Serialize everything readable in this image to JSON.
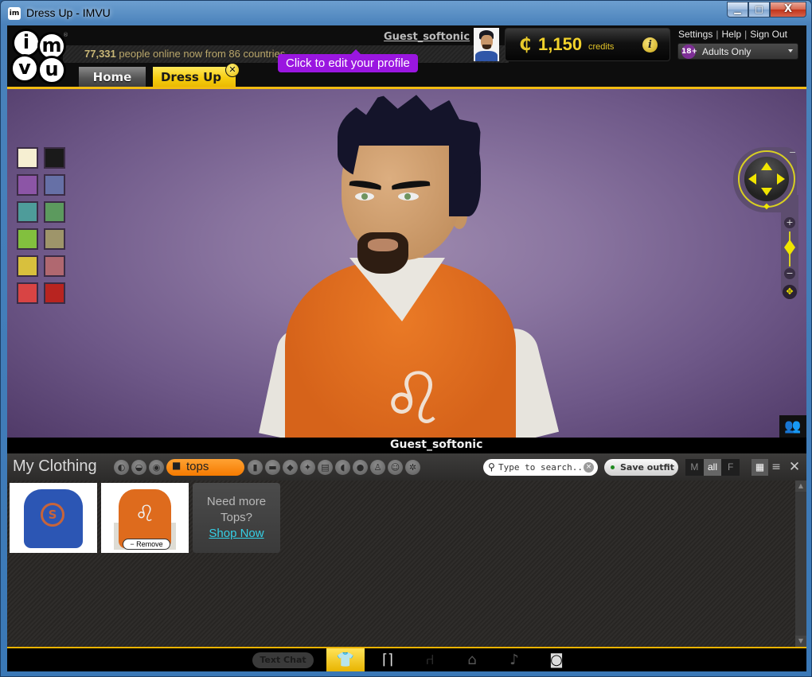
{
  "window": {
    "title": "Dress Up - IMVU",
    "app_icon": "imvu-app-icon",
    "controls": {
      "minimize": "▁",
      "maximize": "□",
      "close": "X"
    }
  },
  "header": {
    "logo": {
      "letters": [
        "i",
        "m",
        "v",
        "u"
      ],
      "registered": "®"
    },
    "online": {
      "count": "77,331",
      "text": "people online now from 86 countries"
    },
    "username": "Guest_softonic",
    "tooltip": "Click to edit your profile",
    "credits": {
      "symbol": "₵",
      "amount": "1,150",
      "label": "credits",
      "info_icon": "i"
    },
    "links": [
      {
        "label": "Settings"
      },
      {
        "label": "Help"
      },
      {
        "label": "Sign Out"
      }
    ],
    "separator": "|",
    "rating": {
      "badge": "18+",
      "label": "Adults Only"
    },
    "tabs": [
      {
        "label": "Home",
        "active": false
      },
      {
        "label": "Dress Up",
        "active": true,
        "closable": true,
        "close_glyph": "✕"
      }
    ]
  },
  "scene": {
    "swatches": [
      {
        "name": "cream",
        "color": "#f6efd2"
      },
      {
        "name": "black",
        "color": "#1a1a1a"
      },
      {
        "name": "purple",
        "color": "#8c55a6"
      },
      {
        "name": "slate-blue",
        "color": "#6670a6"
      },
      {
        "name": "teal",
        "color": "#4e9c9a"
      },
      {
        "name": "green",
        "color": "#5c9a5e"
      },
      {
        "name": "lime",
        "color": "#82c03e"
      },
      {
        "name": "khaki",
        "color": "#9e956a"
      },
      {
        "name": "yellow",
        "color": "#d8c03d"
      },
      {
        "name": "rose",
        "color": "#b06870"
      },
      {
        "name": "red",
        "color": "#d84444"
      },
      {
        "name": "dark-red",
        "color": "#b82420"
      }
    ],
    "nav": {
      "zoom_in": "+",
      "zoom_out": "−",
      "collapse": "−",
      "rotate_glyph": "◆",
      "reset_glyph": "✥"
    },
    "people_icon": "👥",
    "avatar_name": "Guest_softonic",
    "shirt_emblem": "♌"
  },
  "clothing": {
    "title": "My Clothing",
    "categories": [
      {
        "name": "hair",
        "glyph": "◐"
      },
      {
        "name": "lips",
        "glyph": "◒"
      },
      {
        "name": "eyes",
        "glyph": "◉"
      },
      {
        "name": "tops",
        "glyph": "👕",
        "label": "tops",
        "active": true
      },
      {
        "name": "pants",
        "glyph": "▮"
      },
      {
        "name": "shoes",
        "glyph": "▬"
      },
      {
        "name": "jewelry",
        "glyph": "◆"
      },
      {
        "name": "wings",
        "glyph": "✦"
      },
      {
        "name": "actions",
        "glyph": "▤"
      },
      {
        "name": "skins",
        "glyph": "◖"
      },
      {
        "name": "heads",
        "glyph": "●"
      },
      {
        "name": "bodies",
        "glyph": "♙"
      },
      {
        "name": "faces",
        "glyph": "☺"
      },
      {
        "name": "misc",
        "glyph": "✲"
      }
    ],
    "search": {
      "placeholder": "Type to search...",
      "value": "",
      "clear_glyph": "×",
      "icon_glyph": "🔍"
    },
    "save_outfit": "Save outfit",
    "gender_filter": [
      {
        "label": "M",
        "active": false
      },
      {
        "label": "all",
        "active": true
      },
      {
        "label": "F",
        "active": false
      }
    ],
    "view_grid_glyph": "▦",
    "view_list_glyph": "≡",
    "close_glyph": "✕",
    "items": [
      {
        "name": "blue-hoodie",
        "emblem": "S"
      },
      {
        "name": "orange-lion-hoodie",
        "emblem": "♌",
        "worn": true,
        "remove_label": "− Remove"
      }
    ],
    "shop_card": {
      "line1": "Need more",
      "line2": "Tops?",
      "link": "Shop Now"
    },
    "scroll": {
      "up": "▲",
      "down": "▼"
    }
  },
  "bottombar": {
    "text_chat": "Text Chat",
    "buttons": [
      {
        "name": "dress-up",
        "glyph": "👕",
        "active": true
      },
      {
        "name": "wardrobe",
        "glyph": "⌂",
        "active": false
      },
      {
        "name": "furniture",
        "glyph": "⑁",
        "active": false
      },
      {
        "name": "room",
        "glyph": "⌂",
        "active": false
      },
      {
        "name": "music",
        "glyph": "♪",
        "active": false
      },
      {
        "name": "camera",
        "glyph": "◙",
        "active": false
      }
    ]
  }
}
